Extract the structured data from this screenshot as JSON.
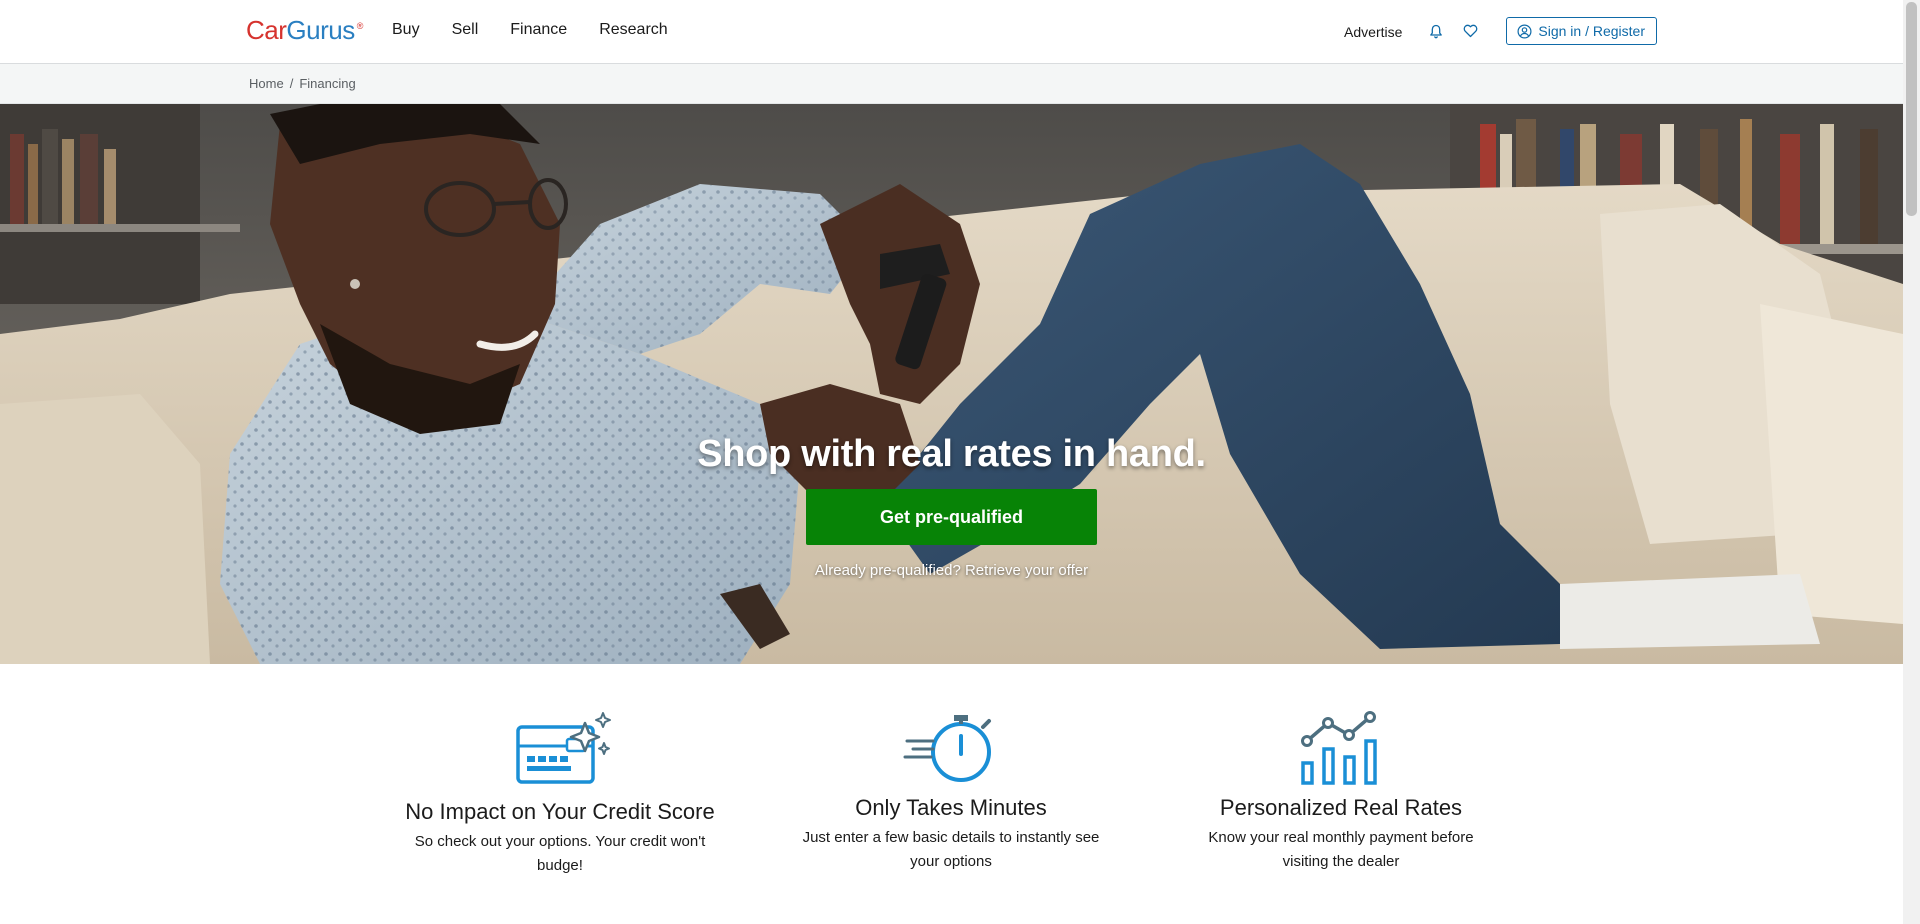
{
  "header": {
    "logo": {
      "car": "Car",
      "gurus": "Gurus",
      "reg": "®"
    },
    "nav": [
      "Buy",
      "Sell",
      "Finance",
      "Research"
    ],
    "advertise": "Advertise",
    "signin": "Sign in / Register",
    "icons": [
      "bell-icon",
      "heart-icon",
      "user-circle-icon"
    ]
  },
  "breadcrumb": {
    "home": "Home",
    "separator": "/",
    "current": "Financing"
  },
  "hero": {
    "title": "Shop with real rates in hand.",
    "cta": "Get pre-qualified",
    "retrieve": "Already pre-qualified? Retrieve your offer"
  },
  "features": [
    {
      "icon": "credit-card-sparkle-icon",
      "title": "No Impact on Your Credit Score",
      "text": "So check out your options. Your credit won't budge!"
    },
    {
      "icon": "stopwatch-icon",
      "title": "Only Takes Minutes",
      "text": "Just enter a few basic details to instantly see your options"
    },
    {
      "icon": "bar-chart-trend-icon",
      "title": "Personalized Real Rates",
      "text": "Know your real monthly payment before visiting the dealer"
    }
  ],
  "colors": {
    "brand_blue": "#0f6aa8",
    "cta_green": "#078306",
    "logo_red": "#d6332e",
    "icon_blue": "#1a8fd6",
    "icon_slate": "#4d6f80"
  }
}
